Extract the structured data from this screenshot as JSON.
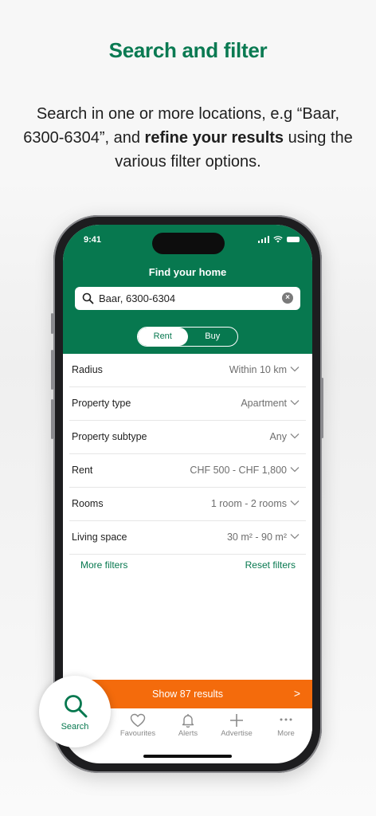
{
  "headline": "Search and filter",
  "subtitle": {
    "part1": "Search in one or more locations, e.g “Baar, 6300-6304”, and ",
    "bold": "refine your results",
    "part2": " using the various filter options."
  },
  "status_bar": {
    "time": "9:41"
  },
  "header": {
    "title": "Find your home",
    "search_value": "Baar, 6300-6304",
    "segments": [
      "Rent",
      "Buy"
    ],
    "active_segment": "Rent"
  },
  "filters": [
    {
      "label": "Radius",
      "value": "Within 10 km"
    },
    {
      "label": "Property type",
      "value": "Apartment"
    },
    {
      "label": "Property subtype",
      "value": "Any"
    },
    {
      "label": "Rent",
      "value": "CHF 500 - CHF 1,800"
    },
    {
      "label": "Rooms",
      "value": "1 room - 2 rooms"
    },
    {
      "label": "Living space",
      "value": "30 m² - 90 m²"
    }
  ],
  "links": {
    "more_filters": "More filters",
    "reset_filters": "Reset filters"
  },
  "show_results": {
    "label": "Show 87 results",
    "arrow": ">"
  },
  "tabbar": {
    "search": "Search",
    "favourites": "Favourites",
    "alerts": "Alerts",
    "advertise": "Advertise",
    "more": "More"
  },
  "colors": {
    "brand_green": "#07784f",
    "cta_orange": "#f46b0c"
  },
  "icons": [
    "search-icon",
    "clear-icon",
    "chevron-down-icon",
    "heart-icon",
    "bell-icon",
    "plus-icon",
    "more-icon"
  ]
}
